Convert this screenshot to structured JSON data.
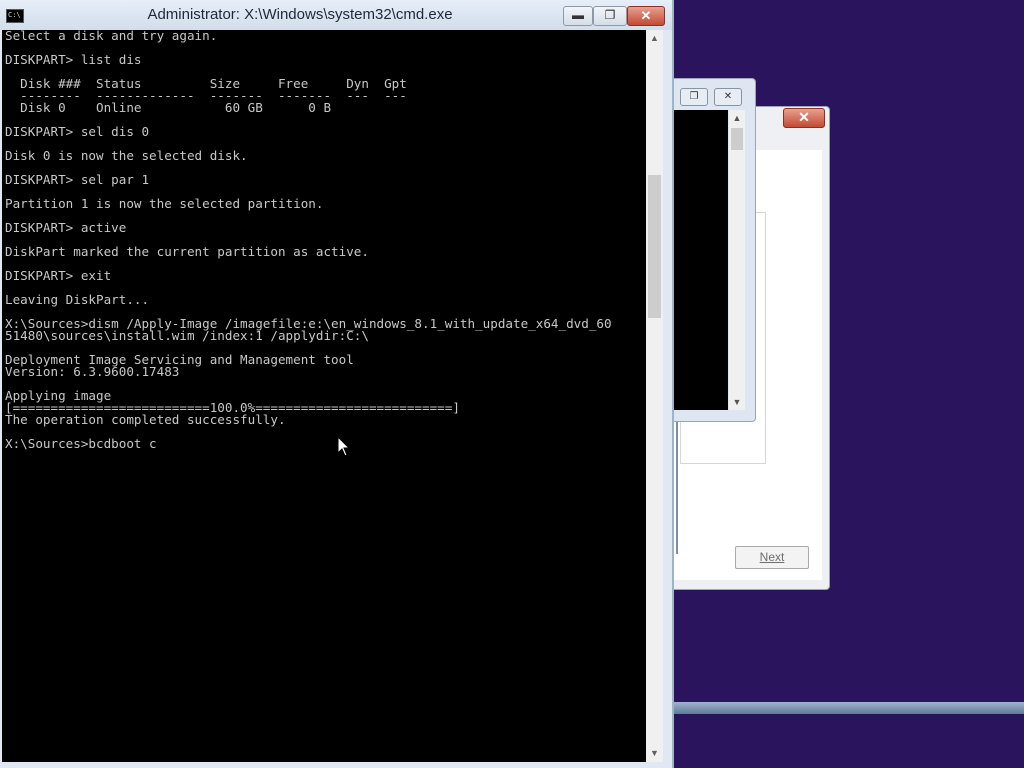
{
  "cmd_window": {
    "title": "Administrator: X:\\Windows\\system32\\cmd.exe",
    "icon_label": "C:\\",
    "buttons": {
      "minimize": "▬",
      "maximize": "❐",
      "close": "✕"
    },
    "console_lines": [
      "Select a disk and try again.",
      "",
      "DISKPART> list dis",
      "",
      "  Disk ###  Status         Size     Free     Dyn  Gpt",
      "  --------  -------------  -------  -------  ---  ---",
      "  Disk 0    Online           60 GB      0 B",
      "",
      "DISKPART> sel dis 0",
      "",
      "Disk 0 is now the selected disk.",
      "",
      "DISKPART> sel par 1",
      "",
      "Partition 1 is now the selected partition.",
      "",
      "DISKPART> active",
      "",
      "DiskPart marked the current partition as active.",
      "",
      "DISKPART> exit",
      "",
      "Leaving DiskPart...",
      "",
      "X:\\Sources>dism /Apply-Image /imagefile:e:\\en_windows_8.1_with_update_x64_dvd_60",
      "51480\\sources\\install.wim /index:1 /applydir:C:\\",
      "",
      "Deployment Image Servicing and Management tool",
      "Version: 6.3.9600.17483",
      "",
      "Applying image",
      "[==========================100.0%==========================]",
      "The operation completed successfully.",
      "",
      "X:\\Sources>bcdboot c"
    ]
  },
  "background_cmd": {
    "buttons": {
      "maximize": "❐",
      "close": "✕"
    }
  },
  "setup_window": {
    "close_label": "✕",
    "next_button": "Next"
  }
}
